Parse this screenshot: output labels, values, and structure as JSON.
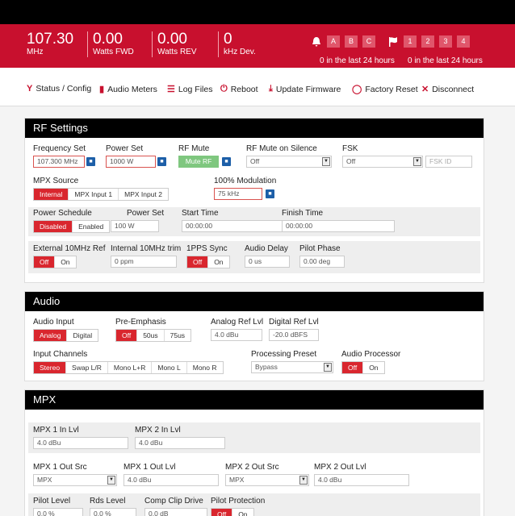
{
  "header": {
    "freq": {
      "value": "107.30",
      "unit": "MHz"
    },
    "fwd": {
      "value": "0.00",
      "unit": "Watts FWD"
    },
    "rev": {
      "value": "0.00",
      "unit": "Watts REV"
    },
    "dev": {
      "value": "0",
      "unit": "kHz Dev."
    },
    "alarms_left": {
      "boxes": [
        "A",
        "B",
        "C"
      ],
      "text": "0 in the last 24 hours"
    },
    "alarms_right": {
      "boxes": [
        "1",
        "2",
        "3",
        "4"
      ],
      "text": "0 in the last 24 hours"
    }
  },
  "nav": {
    "status": "Status / Config",
    "meters": "Audio Meters",
    "logs": "Log Files",
    "reboot": "Reboot",
    "firmware": "Update Firmware",
    "factory": "Factory Reset",
    "disconnect": "Disconnect"
  },
  "rf": {
    "title": "RF Settings",
    "freq_label": "Frequency Set",
    "freq_value": "107.300 MHz",
    "power_label": "Power Set",
    "power_value": "1000 W",
    "mute_label": "RF Mute",
    "mute_button": "Mute RF",
    "mute_silence_label": "RF Mute on Silence",
    "mute_silence_value": "Off",
    "fsk_label": "FSK",
    "fsk_value": "Off",
    "fsk_id_placeholder": "FSK ID",
    "mpx_source_label": "MPX Source",
    "mpx_source_options": [
      "Internal",
      "MPX Input 1",
      "MPX Input 2"
    ],
    "mod_label": "100% Modulation",
    "mod_value": "75 kHz",
    "sched_label": "Power Schedule",
    "sched_options": [
      "Disabled",
      "Enabled"
    ],
    "sched_power_label": "Power Set",
    "sched_power_value": "100 W",
    "start_label": "Start Time",
    "start_value": "00:00:00",
    "finish_label": "Finish Time",
    "finish_value": "00:00:00",
    "ext_label": "External 10MHz Ref",
    "ext_options": [
      "Off",
      "On"
    ],
    "trim_label": "Internal 10MHz trim",
    "trim_value": "0 ppm",
    "pps_label": "1PPS Sync",
    "pps_options": [
      "Off",
      "On"
    ],
    "delay_label": "Audio Delay",
    "delay_value": "0 us",
    "pilot_label": "Pilot Phase",
    "pilot_value": "0.00 deg"
  },
  "audio": {
    "title": "Audio",
    "input_label": "Audio Input",
    "input_options": [
      "Analog",
      "Digital"
    ],
    "pre_label": "Pre-Emphasis",
    "pre_options": [
      "Off",
      "50us",
      "75us"
    ],
    "analog_label": "Analog Ref Lvl",
    "analog_value": "4.0 dBu",
    "digital_label": "Digital Ref Lvl",
    "digital_value": "-20.0 dBFS",
    "channels_label": "Input Channels",
    "channels_options": [
      "Stereo",
      "Swap L/R",
      "Mono L+R",
      "Mono L",
      "Mono R"
    ],
    "preset_label": "Processing Preset",
    "preset_value": "Bypass",
    "proc_label": "Audio Processor",
    "proc_options": [
      "Off",
      "On"
    ]
  },
  "mpx": {
    "title": "MPX",
    "in1_label": "MPX 1 In Lvl",
    "in1_value": "4.0 dBu",
    "in2_label": "MPX 2 In Lvl",
    "in2_value": "4.0 dBu",
    "out1src_label": "MPX 1 Out Src",
    "out1src_value": "MPX",
    "out1lvl_label": "MPX 1 Out Lvl",
    "out1lvl_value": "4.0 dBu",
    "out2src_label": "MPX 2 Out Src",
    "out2src_value": "MPX",
    "out2lvl_label": "MPX 2 Out Lvl",
    "out2lvl_value": "4.0 dBu",
    "pilot_label": "Pilot Level",
    "pilot_value": "0.0 %",
    "rds_label": "Rds Level",
    "rds_value": "0.0 %",
    "clip_label": "Comp Clip Drive",
    "clip_value": "0.0 dB",
    "prot_label": "Pilot Protection",
    "prot_options": [
      "Off",
      "On"
    ]
  },
  "colors": {
    "accent": "#c8102e",
    "active": "#d9262e",
    "mute": "#7fc77f",
    "lock": "#1d5fa8"
  }
}
